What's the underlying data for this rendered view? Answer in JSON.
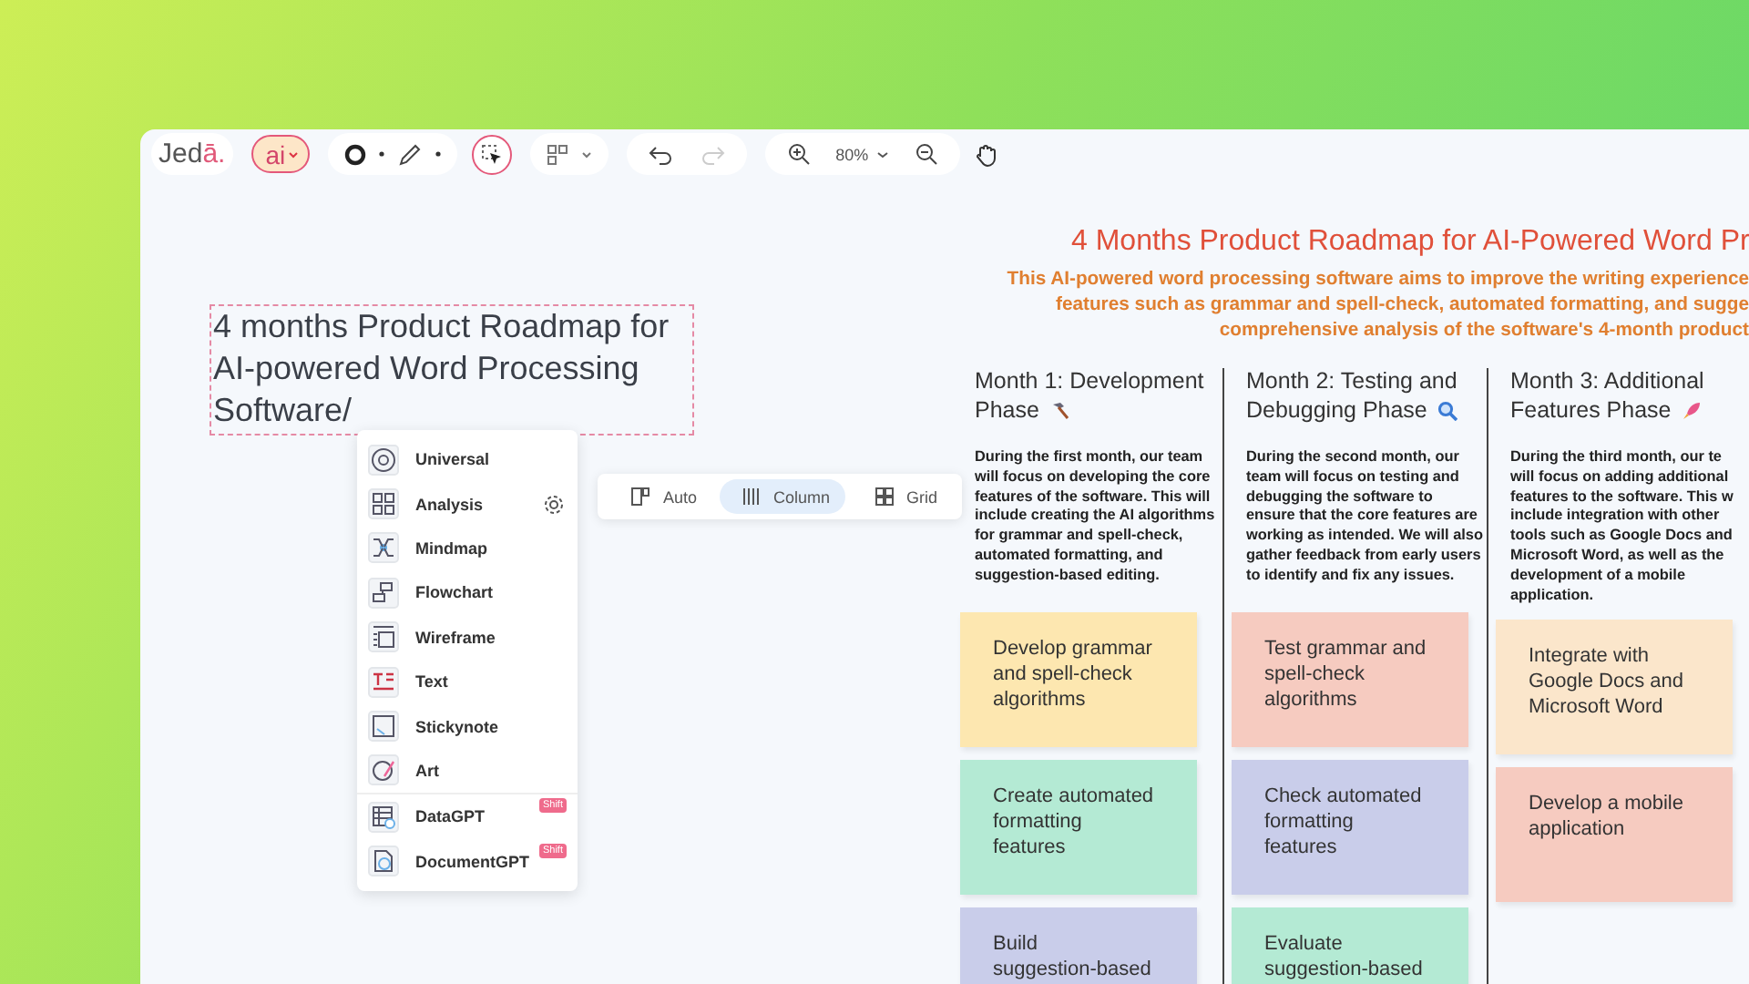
{
  "toolbar": {
    "logo_main": "Jed",
    "logo_accent": "ā.",
    "ai_button": "ai",
    "zoom": "80%"
  },
  "text_box": {
    "text": "4 months Product Roadmap for AI-powered Word Processing Software/"
  },
  "insert_menu": [
    {
      "label": "Universal"
    },
    {
      "label": "Analysis",
      "settings": true
    },
    {
      "label": "Mindmap"
    },
    {
      "label": "Flowchart"
    },
    {
      "label": "Wireframe"
    },
    {
      "label": "Text"
    },
    {
      "label": "Stickynote"
    },
    {
      "label": "Art"
    },
    {
      "label": "DataGPT",
      "badge": "Shift"
    },
    {
      "label": "DocumentGPT",
      "badge": "Shift"
    }
  ],
  "layout_options": [
    {
      "label": "Auto",
      "selected": false
    },
    {
      "label": "Column",
      "selected": true
    },
    {
      "label": "Grid",
      "selected": false
    }
  ],
  "roadmap": {
    "title": "4 Months Product Roadmap for AI-Powered Word Pr",
    "subtitle": "This AI-powered word processing software aims to improve the writing experience\nfeatures such as grammar and spell-check, automated formatting, and sugge\ncomprehensive analysis of the software's 4-month product",
    "months": [
      {
        "heading": [
          "Month 1: Development",
          "Phase"
        ],
        "description": "During the first month, our team\nwill focus on developing the core\nfeatures of the software. This will\ninclude creating the AI algorithms\nfor grammar and spell-check,\nautomated formatting, and\nsuggestion-based editing.",
        "notes": [
          {
            "text": "Develop grammar\nand spell-check\nalgorithms",
            "color": "#fde7b0"
          },
          {
            "text": "Create automated\nformatting\nfeatures",
            "color": "#b4ead4"
          },
          {
            "text": "Build\nsuggestion-based",
            "color": "#c9cdea"
          }
        ]
      },
      {
        "heading": [
          "Month 2: Testing and",
          "Debugging Phase"
        ],
        "description": "During the second month, our\nteam will focus on testing and\ndebugging the software to\nensure that the core features are\nworking as intended. We will also\ngather feedback from early users\nto identify and fix any issues.",
        "notes": [
          {
            "text": "Test grammar and\nspell-check\nalgorithms",
            "color": "#f6cbc0"
          },
          {
            "text": "Check automated\nformatting\nfeatures",
            "color": "#c9cdea"
          },
          {
            "text": "Evaluate\nsuggestion-based",
            "color": "#b4ead4"
          }
        ]
      },
      {
        "heading": [
          "Month 3: Additional",
          "Features Phase"
        ],
        "description": "During the third month, our te\nwill focus on adding additional\nfeatures to the software. This w\ninclude integration with other\ntools such as Google Docs and\nMicrosoft Word, as well as the\ndevelopment of a mobile\napplication.",
        "notes": [
          {
            "text": "Integrate with\nGoogle Docs and\nMicrosoft Word",
            "color": "#fbe6cb"
          },
          {
            "text": "Develop a mobile\napplication",
            "color": "#f6cbc0"
          }
        ]
      }
    ]
  }
}
